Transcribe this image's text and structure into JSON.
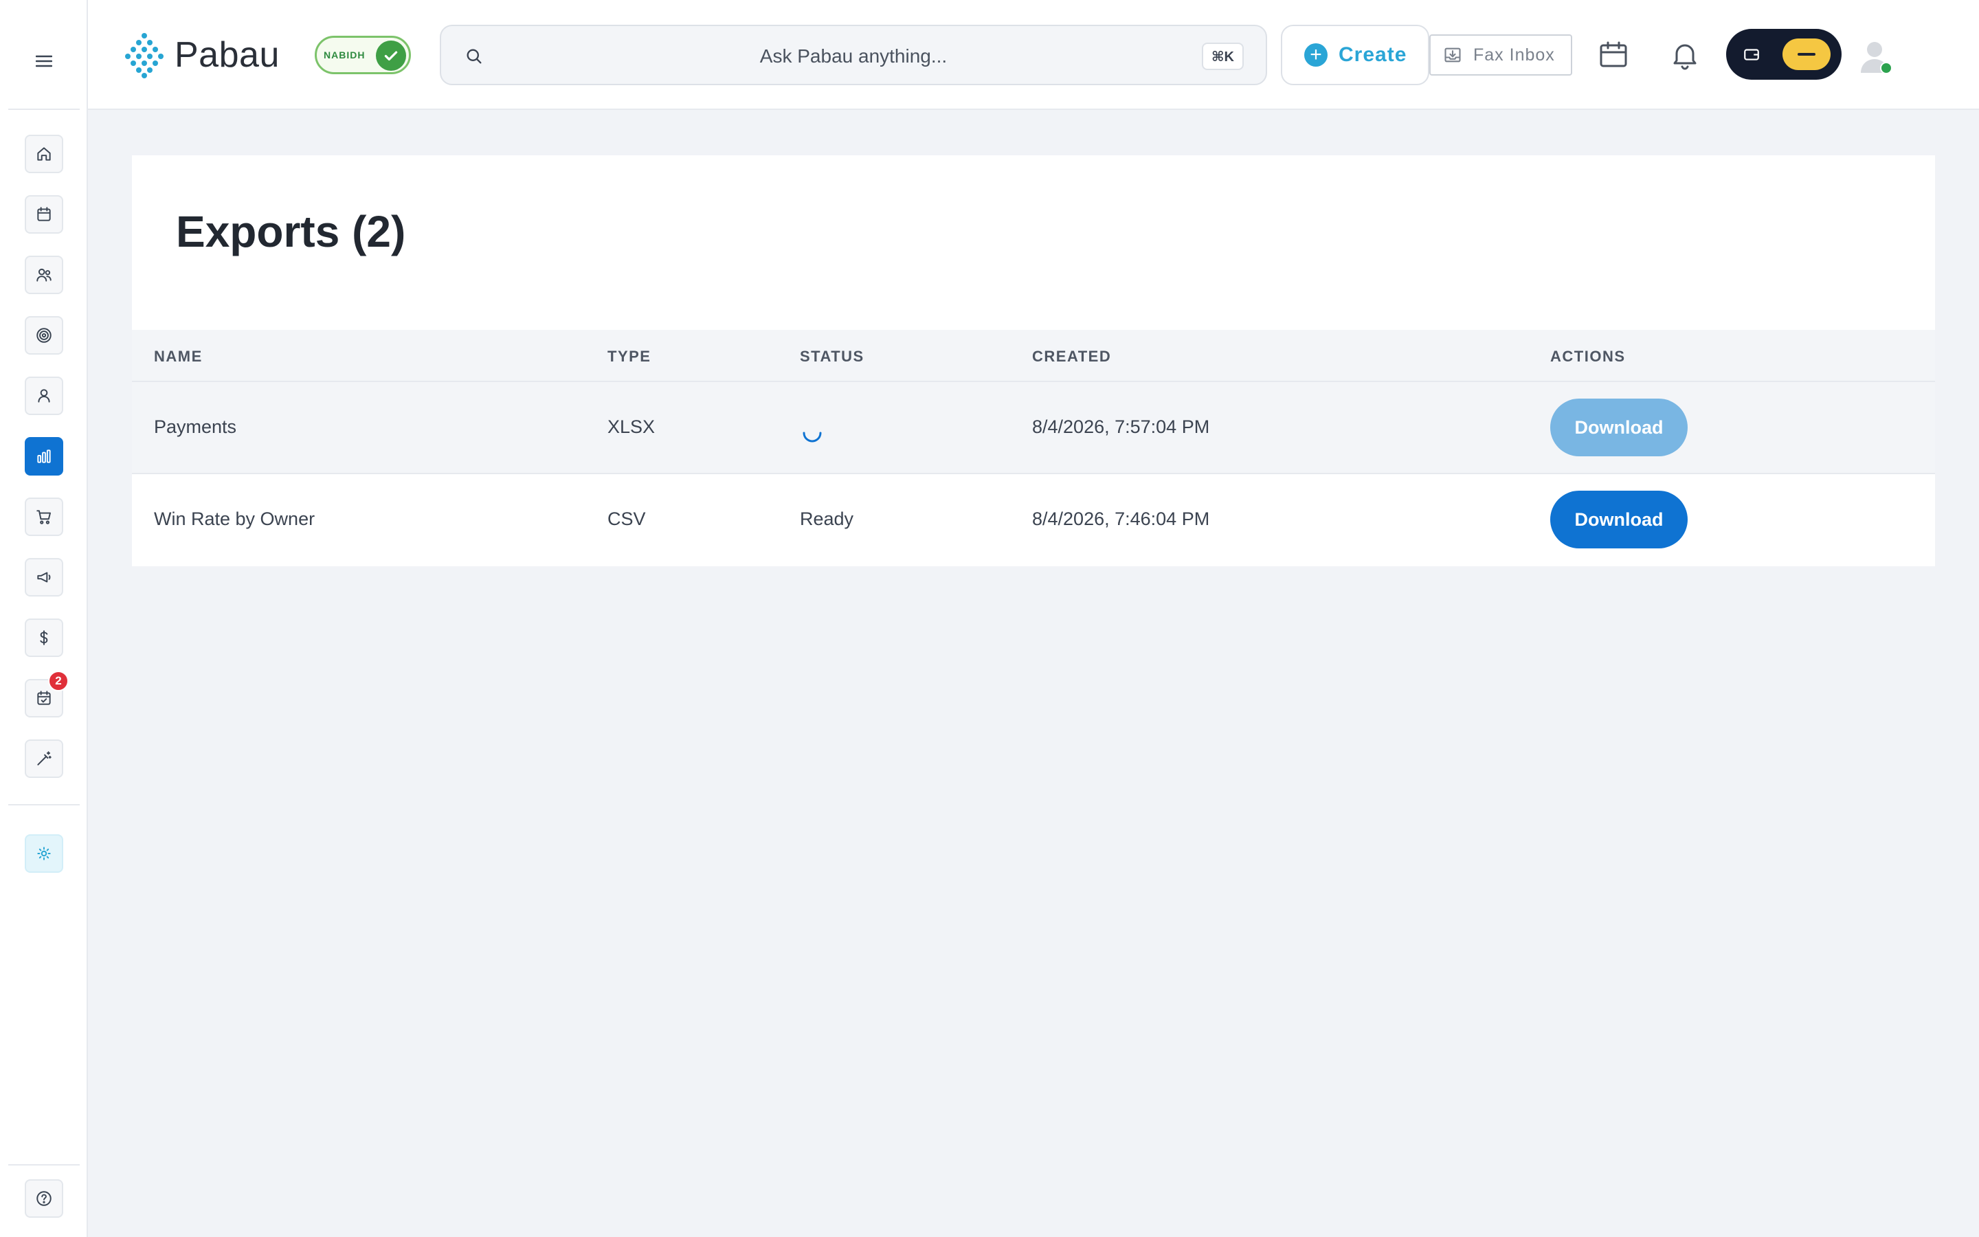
{
  "app": {
    "name": "Pabau",
    "badge_text": "NABIDH"
  },
  "search": {
    "placeholder": "Ask Pabau anything...",
    "shortcut": "⌘K"
  },
  "header": {
    "create_label": "Create",
    "fax_label": "Fax Inbox"
  },
  "sidebar": {
    "active_item": "reports",
    "items": [
      {
        "id": "home",
        "icon": "home-icon"
      },
      {
        "id": "calendar",
        "icon": "calendar-icon"
      },
      {
        "id": "leads",
        "icon": "users-icon"
      },
      {
        "id": "goals",
        "icon": "target-icon"
      },
      {
        "id": "contacts",
        "icon": "user-icon"
      },
      {
        "id": "reports",
        "icon": "bar-chart-icon"
      },
      {
        "id": "shop",
        "icon": "cart-icon"
      },
      {
        "id": "marketing",
        "icon": "megaphone-icon"
      },
      {
        "id": "finance",
        "icon": "dollar-icon"
      },
      {
        "id": "tasks",
        "icon": "calendar-check-icon",
        "badge": "2"
      },
      {
        "id": "tools",
        "icon": "magic-wand-icon"
      },
      {
        "id": "setup",
        "icon": "sun-icon"
      },
      {
        "id": "help",
        "icon": "help-icon"
      }
    ]
  },
  "page": {
    "title": "Exports (2)"
  },
  "table": {
    "columns": [
      "NAME",
      "TYPE",
      "STATUS",
      "CREATED",
      "ACTIONS"
    ],
    "rows": [
      {
        "name": "Payments",
        "type": "XLSX",
        "status": "",
        "status_loading": true,
        "created": "8/4/2026, 7:57:04 PM",
        "action": "Download",
        "action_disabled": true
      },
      {
        "name": "Win Rate by Owner",
        "type": "CSV",
        "status": "Ready",
        "status_loading": false,
        "created": "8/4/2026, 7:46:04 PM",
        "action": "Download",
        "action_disabled": false
      }
    ]
  },
  "colors": {
    "primary": "#0f73d2",
    "brand_teal": "#2aa5d6",
    "toggle_bg": "#131b2e",
    "toggle_knob": "#f5c742",
    "badge_red": "#e0303a"
  }
}
